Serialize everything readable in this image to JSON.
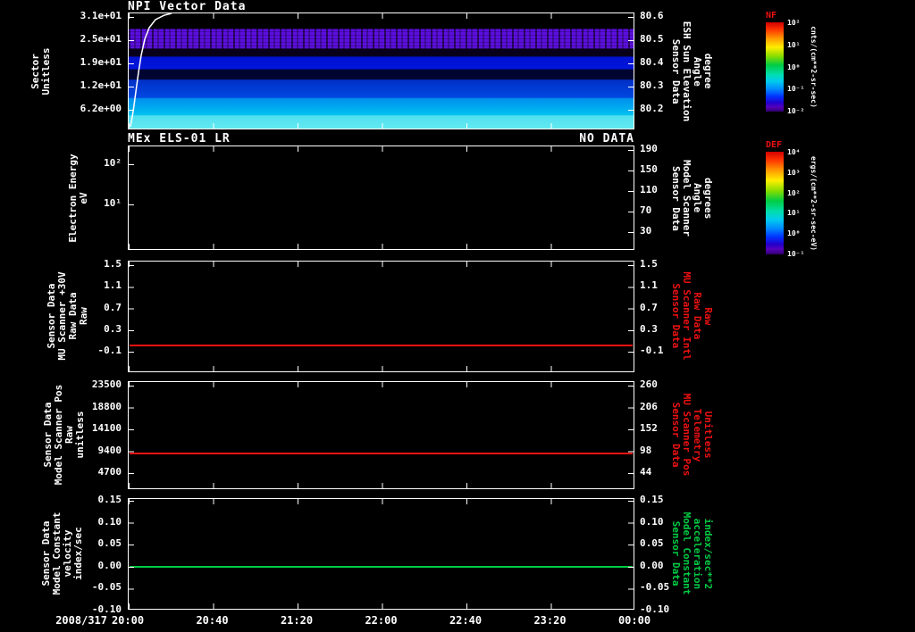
{
  "colors": {
    "background": "#000000",
    "foreground": "#ffffff",
    "red_accent": "#ee1111",
    "green_accent": "#00cc44"
  },
  "xaxis": {
    "date": "2008/317",
    "ticks": [
      "20:00",
      "20:40",
      "21:20",
      "22:00",
      "22:40",
      "23:20",
      "00:00"
    ]
  },
  "panel1": {
    "title": "NPI Vector Data",
    "left_label": [
      "Sector",
      "Unitless"
    ],
    "left_ticks": [
      "3.1e+01",
      "2.5e+01",
      "1.9e+01",
      "1.2e+01",
      "6.2e+00"
    ],
    "right_ticks": [
      "80.6",
      "80.5",
      "80.4",
      "80.3",
      "80.2"
    ],
    "right_label": [
      "Sensor Data",
      "ESH Sun Elevation",
      "Angle",
      "degree"
    ]
  },
  "panel2": {
    "title": "MEx ELS-01 LR",
    "no_data": "NO DATA",
    "left_label": [
      "Electron Energy",
      "eV"
    ],
    "left_ticks": [
      "10²",
      "10¹"
    ],
    "right_ticks": [
      "190",
      "150",
      "110",
      "70",
      "30"
    ],
    "right_label": [
      "Sensor Data",
      "Model Scanner",
      "Angle",
      "degrees"
    ]
  },
  "panel3": {
    "left_label": [
      "Sensor Data",
      "MU Scanner +30V",
      "Raw Data",
      "Raw"
    ],
    "left_ticks": [
      "1.5",
      "1.1",
      "0.7",
      "0.3",
      "-0.1"
    ],
    "right_ticks": [
      "1.5",
      "1.1",
      "0.7",
      "0.3",
      "-0.1"
    ],
    "right_label": [
      "Sensor Data",
      "MU Scanner Intl",
      "Raw Data",
      "Raw"
    ]
  },
  "panel4": {
    "left_label": [
      "Sensor Data",
      "Model Scanner Pos",
      "Raw",
      "unitless"
    ],
    "left_ticks": [
      "23500",
      "18800",
      "14100",
      "9400",
      "4700"
    ],
    "right_ticks": [
      "260",
      "206",
      "152",
      "98",
      "44"
    ],
    "right_label": [
      "Sensor Data",
      "MU Scanner Pos",
      "Telemetry",
      "Unitless"
    ]
  },
  "panel5": {
    "left_label": [
      "Sensor Data",
      "Model Constant",
      "velocity",
      "index/sec"
    ],
    "left_ticks": [
      "0.15",
      "0.10",
      "0.05",
      "0.00",
      "-0.05",
      "-0.10"
    ],
    "right_ticks": [
      "0.15",
      "0.10",
      "0.05",
      "0.00",
      "-0.05",
      "-0.10"
    ],
    "right_label": [
      "Sensor Data",
      "Model Constant",
      "acceleration",
      "index/sec**2"
    ]
  },
  "colorbar1": {
    "name": "NF",
    "ticks": [
      "10²",
      "10¹",
      "10⁰",
      "10⁻¹",
      "10⁻²"
    ],
    "units": "cnts/(cm**2-sr-sec)"
  },
  "colorbar2": {
    "name": "DEF",
    "ticks": [
      "10⁴",
      "10³",
      "10²",
      "10¹",
      "10⁰",
      "10⁻¹"
    ],
    "units": "ergs/(cm**2-sr-sec-eV)"
  },
  "chart_data": [
    {
      "type": "heatmap",
      "title": "NPI Vector Data",
      "ylabel": "Sector Unitless",
      "y_ticks": [
        "3.1e+01",
        "2.5e+01",
        "1.9e+01",
        "1.2e+01",
        "6.2e+00"
      ],
      "y2_label": "Sensor Data ESH Sun Elevation Angle degree",
      "y2_ticks": [
        80.6,
        80.5,
        80.4,
        80.3,
        80.2
      ],
      "x_start": "2008/317 20:00",
      "x_end": "2008/318 00:00",
      "x_ticks": [
        "20:00",
        "20:40",
        "21:20",
        "22:00",
        "22:40",
        "23:20",
        "00:00"
      ],
      "colorbar": {
        "label": "NF",
        "units": "cnts/(cm**2-sr-sec)",
        "range": [
          "10^-2",
          "10^2"
        ]
      },
      "bands": [
        {
          "approx_sector": "24-28",
          "color": "violet",
          "note": "speckled with data dropouts"
        },
        {
          "approx_sector": "18-20",
          "color": "deep blue",
          "note": "solid"
        },
        {
          "approx_sector": "7-13",
          "color": "blue",
          "note": "solid"
        },
        {
          "approx_sector": "1-6",
          "color": "cyan",
          "note": "brightest counts at lowest sectors"
        }
      ],
      "overlay_line": {
        "name": "sun elevation",
        "start": 80.2,
        "note": "white line rises steeply off top scale near 20:05"
      }
    },
    {
      "type": "heatmap",
      "title": "MEx ELS-01 LR",
      "annotation": "NO DATA",
      "ylabel": "Electron Energy eV",
      "y_scale": "log",
      "y_ticks": [
        "10^2",
        "10^1"
      ],
      "y2_label": "Sensor Data Model Scanner Angle degrees",
      "y2_ticks": [
        190,
        150,
        110,
        70,
        30
      ],
      "colorbar": {
        "label": "DEF",
        "units": "ergs/(cm**2-sr-sec-eV)",
        "range": [
          "10^-1",
          "10^4"
        ]
      },
      "values": "empty panel - no data plotted"
    },
    {
      "type": "line",
      "ylabel": "Sensor Data MU Scanner +30V Raw Data Raw",
      "y2_label": "Sensor Data MU Scanner Intl Raw Data Raw",
      "y_ticks": [
        1.5,
        1.1,
        0.7,
        0.3,
        -0.1
      ],
      "y2_ticks": [
        1.5,
        1.1,
        0.7,
        0.3,
        -0.1
      ],
      "series": [
        {
          "name": "MU Scanner +30V Raw",
          "color": "#ee1111",
          "value": "constant ~0.0 across full time range"
        }
      ]
    },
    {
      "type": "line",
      "ylabel": "Sensor Data Model Scanner Pos Raw unitless",
      "y2_label": "Sensor Data MU Scanner Pos Telemetry Unitless",
      "y_ticks": [
        23500,
        18800,
        14100,
        9400,
        4700
      ],
      "y2_ticks": [
        260,
        206,
        152,
        98,
        44
      ],
      "series": [
        {
          "name": "Model Scanner Pos Raw",
          "color": "#ee1111",
          "value": "constant ~8800 (telemetry ~97) across full time range"
        }
      ]
    },
    {
      "type": "line",
      "ylabel": "Sensor Data Model Constant velocity index/sec",
      "y2_label": "Sensor Data Model Constant acceleration index/sec**2",
      "y_ticks": [
        0.15,
        0.1,
        0.05,
        0.0,
        -0.05,
        -0.1
      ],
      "y2_ticks": [
        0.15,
        0.1,
        0.05,
        0.0,
        -0.05,
        -0.1
      ],
      "series": [
        {
          "name": "Model Constant velocity",
          "color": "#00cc44",
          "value": "constant 0.00 across full time range"
        }
      ]
    }
  ]
}
